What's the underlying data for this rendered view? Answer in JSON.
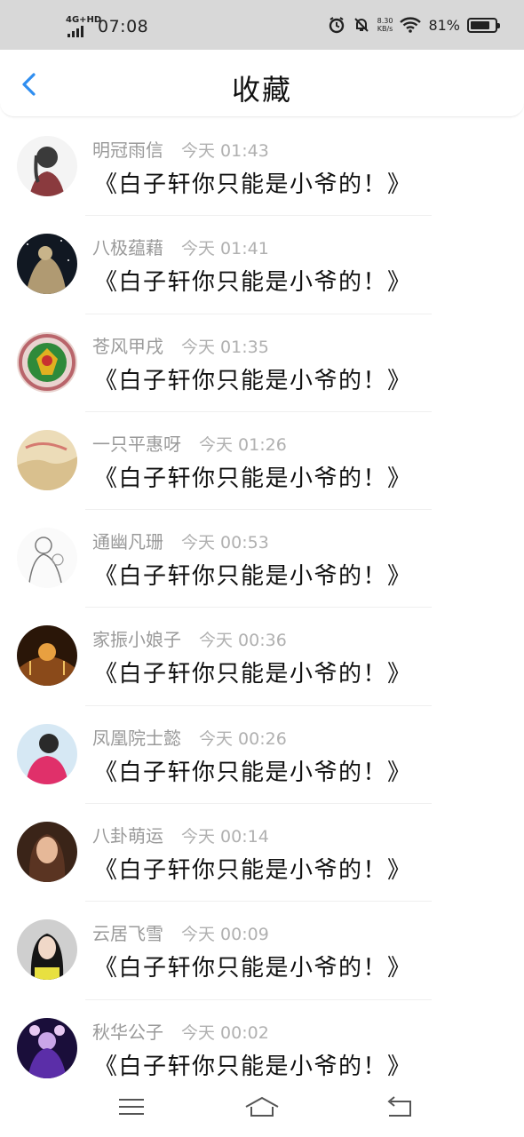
{
  "status_bar": {
    "network": "4G+HD",
    "time": "07:08",
    "speed_value": "8.30",
    "speed_unit": "KB/s",
    "battery_percent": "81%",
    "battery_level": 0.81
  },
  "header": {
    "title": "收藏"
  },
  "favorites": [
    {
      "name": "明冠雨信",
      "time": "今天 01:43",
      "message": "《白子轩你只能是小爷的！》"
    },
    {
      "name": "八极蕴藉",
      "time": "今天 01:41",
      "message": "《白子轩你只能是小爷的！》"
    },
    {
      "name": "苍风甲戌",
      "time": "今天 01:35",
      "message": "《白子轩你只能是小爷的！》"
    },
    {
      "name": "一只平惠呀",
      "time": "今天 01:26",
      "message": "《白子轩你只能是小爷的！》"
    },
    {
      "name": "通幽凡珊",
      "time": "今天 00:53",
      "message": "《白子轩你只能是小爷的！》"
    },
    {
      "name": "家振小娘子",
      "time": "今天 00:36",
      "message": "《白子轩你只能是小爷的！》"
    },
    {
      "name": "凤凰院士懿",
      "time": "今天 00:26",
      "message": "《白子轩你只能是小爷的！》"
    },
    {
      "name": "八卦萌运",
      "time": "今天 00:14",
      "message": "《白子轩你只能是小爷的！》"
    },
    {
      "name": "云居飞雪",
      "time": "今天 00:09",
      "message": "《白子轩你只能是小爷的！》"
    },
    {
      "name": "秋华公子",
      "time": "今天 00:02",
      "message": "《白子轩你只能是小爷的！》"
    }
  ],
  "colors": {
    "accent": "#2f8ef0",
    "status_bar_bg": "#d8d8d8"
  },
  "nav": {
    "icons": [
      "menu-icon",
      "home-icon",
      "back-icon"
    ]
  }
}
